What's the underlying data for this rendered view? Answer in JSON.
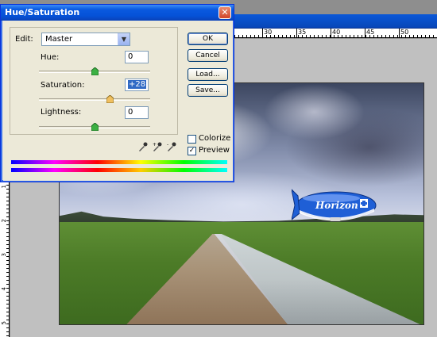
{
  "dialog": {
    "title": "Hue/Saturation",
    "close_glyph": "✕",
    "edit_label": "Edit:",
    "edit_value": "Master",
    "hue": {
      "label": "Hue:",
      "value": "0",
      "slider_fraction": 0.5
    },
    "saturation": {
      "label": "Saturation:",
      "value": "+28",
      "slider_fraction": 0.64
    },
    "lightness": {
      "label": "Lightness:",
      "value": "0",
      "slider_fraction": 0.5
    },
    "buttons": {
      "ok": "OK",
      "cancel": "Cancel",
      "load": "Load...",
      "save": "Save..."
    },
    "colorize": {
      "label": "Colorize",
      "checked": false
    },
    "preview": {
      "label": "Preview",
      "checked": true
    },
    "icons": [
      "eyedropper-icon",
      "eyedropper-plus-icon",
      "eyedropper-minus-icon"
    ]
  },
  "ruler": {
    "top_labels": [
      "30",
      "35",
      "40",
      "45",
      "50"
    ],
    "left_labels": [
      "1",
      "2",
      "3",
      "4",
      "5"
    ]
  },
  "photo": {
    "blimp_text": "Horizon"
  },
  "colors": {
    "titlebar": "#0552d8",
    "dialog_bg": "#ece9d8",
    "blimp": "#1f5fd6"
  }
}
